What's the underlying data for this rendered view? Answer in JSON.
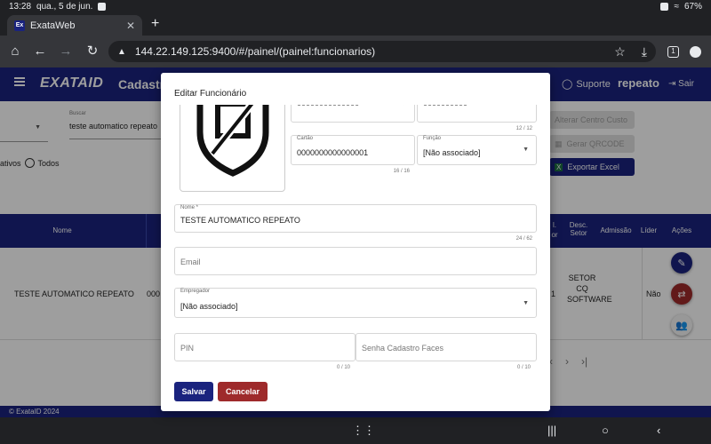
{
  "status_bar": {
    "time": "13:28",
    "date": "qua., 5 de jun.",
    "battery": "67%"
  },
  "browser": {
    "tab_title": "ExataWeb",
    "favicon_text": "Ex",
    "url": "144.22.149.125:9400/#/painel/(painel:funcionarios)",
    "tab_count": "1"
  },
  "app": {
    "logo": "EXATAID",
    "page_title": "Cadastro",
    "support_label": "Suporte",
    "user_name": "repeato",
    "logout_label": "Sair",
    "footer": "© ExataID 2024"
  },
  "background_page": {
    "search_label": "Buscar",
    "search_value": "teste automatico repeato",
    "radio_partial": "ativos",
    "radio_all": "Todos",
    "btn_alterar_centro": "Alterar Centro Custo",
    "btn_gerar_qrcode": "Gerar QRCODE",
    "btn_exportar": "Exportar Excel",
    "table_headers": {
      "nome": "Nome",
      "cod": "l.",
      "sub": "or",
      "desc_setor": "Desc. Setor",
      "admissao": "Admissão",
      "lider": "Líder",
      "acoes": "Ações"
    },
    "row": {
      "nome": "TESTE AUTOMATICO REPEATO",
      "codigo": "000",
      "num": "1",
      "setor": "SETOR CQ SOFTWARE",
      "lider": "Não"
    }
  },
  "dialog": {
    "title": "Editar Funcionário",
    "top_left_partial": "00000000000000",
    "top_right_partial": "0000000000",
    "top_counter": "12 / 12",
    "cartao_label": "Cartão",
    "cartao_value": "0000000000000001",
    "cartao_counter": "16 / 16",
    "funcao_label": "Função",
    "funcao_value": "[Não associado]",
    "nome_label": "Nome *",
    "nome_value": "TESTE AUTOMATICO REPEATO",
    "nome_counter": "24 / 62",
    "email_placeholder": "Email",
    "empregador_label": "Empregador",
    "empregador_value": "[Não associado]",
    "pin_placeholder": "PIN",
    "pin_counter": "0 / 10",
    "senha_placeholder": "Senha Cadastro Faces",
    "senha_counter": "0 / 10",
    "save_label": "Salvar",
    "cancel_label": "Cancelar"
  },
  "colors": {
    "brand": "#1a237e",
    "cancel": "#9e2a2b",
    "primary_button": "#1a237e"
  }
}
